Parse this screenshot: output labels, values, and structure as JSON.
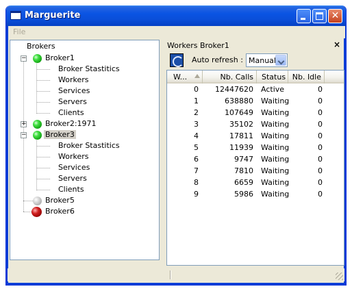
{
  "window": {
    "title": "Marguerite"
  },
  "menu": {
    "file": "File"
  },
  "tree": {
    "root": "Brokers",
    "brokers": [
      {
        "label": "Broker1",
        "status": "green",
        "expanded": true,
        "children": [
          "Broker Stastitics",
          "Workers",
          "Services",
          "Servers",
          "Clients"
        ]
      },
      {
        "label": "Broker2:1971",
        "status": "green",
        "expanded": false,
        "children": []
      },
      {
        "label": "Broker3",
        "status": "green",
        "expanded": true,
        "selected": true,
        "children": [
          "Broker Stastitics",
          "Workers",
          "Services",
          "Servers",
          "Clients"
        ]
      },
      {
        "label": "Broker5",
        "status": "grey",
        "expanded": false,
        "children": []
      },
      {
        "label": "Broker6",
        "status": "red",
        "expanded": false,
        "children": []
      }
    ]
  },
  "dock": {
    "title": "Workers Broker1",
    "close": "×",
    "auto_refresh_label": "Auto refresh :",
    "auto_refresh_value": "Manual"
  },
  "table": {
    "columns": [
      "W...",
      "Nb. Calls",
      "Status",
      "Nb. Idle"
    ],
    "rows": [
      [
        "0",
        "12447620",
        "Active",
        "0"
      ],
      [
        "1",
        "638880",
        "Waiting",
        "0"
      ],
      [
        "2",
        "107649",
        "Waiting",
        "0"
      ],
      [
        "3",
        "35102",
        "Waiting",
        "0"
      ],
      [
        "4",
        "17811",
        "Waiting",
        "0"
      ],
      [
        "5",
        "11939",
        "Waiting",
        "0"
      ],
      [
        "6",
        "9747",
        "Waiting",
        "0"
      ],
      [
        "7",
        "7810",
        "Waiting",
        "0"
      ],
      [
        "8",
        "6659",
        "Waiting",
        "0"
      ],
      [
        "9",
        "5986",
        "Waiting",
        "0"
      ]
    ]
  }
}
